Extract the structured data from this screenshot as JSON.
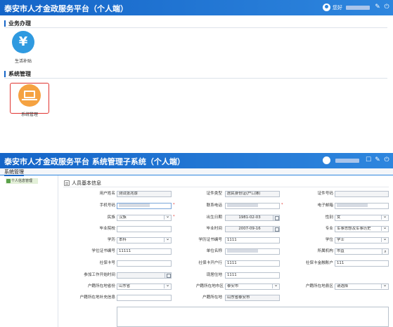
{
  "panel1": {
    "app_title": "泰安市人才金政服务平台（个人端）",
    "greeting": "您好",
    "section_business": "业务办理",
    "tile_subsidy": "生活补贴",
    "tile_subsidy_glyph": "¥",
    "section_system": "系统管理",
    "tile_system": "系统管理",
    "icons": [
      "user-icon",
      "wrench-icon",
      "power-icon",
      "yen-icon",
      "laptop-icon"
    ]
  },
  "panel2": {
    "app_title": "泰安市人才金政服务平台   系统管理子系统（个人端）",
    "nav_tab": "系统管理",
    "side_item": "个人信息管理",
    "form_title": "人员基本信息",
    "icons": [
      "user-icon",
      "edit-icon",
      "wrench-icon",
      "power-icon"
    ],
    "labels": {
      "name": "用户姓名",
      "id_type": "证件类型",
      "id_no": "证件号码",
      "phone": "手机号码",
      "contact_phone": "联系电话",
      "email": "电子邮箱",
      "ethnicity": "民族",
      "birth": "出生日期",
      "gender": "性别",
      "grad_school": "毕业院校",
      "grad_time": "毕业时间",
      "major": "专业",
      "education": "学历",
      "edu_cert_no": "学历证书编号",
      "degree": "学位",
      "degree_cert_no": "学位证书编号",
      "employer": "单位名称",
      "institution": "所属机构",
      "ss_card_no": "社保卡号",
      "ss_bank": "社保卡开户行",
      "ss_finance": "社保卡金融账户",
      "work_start": "参加工作开始时间",
      "current_addr": "现居住地",
      "hukou_prov": "户籍所在地省份",
      "hukou_city": "户籍所在地市区",
      "hukou_county": "户籍所在地县区",
      "hukou_detail": "户籍所在地补充信息",
      "hukou_full": "户籍所在地"
    },
    "values": {
      "name": "测试张兆厚",
      "id_type": "居民身份证(户口簿)",
      "ethnicity": "汉族",
      "birth": "1981-02-03",
      "gender": "女",
      "grad_time": "2007-09-16",
      "major": "军事思想及军事历史",
      "education": "本科",
      "edu_cert_no": "1111",
      "degree": "学士",
      "degree_cert_no": "11111",
      "institution": "市直",
      "ss_bank": "1111",
      "ss_finance": "111",
      "current_addr": "1111",
      "hukou_prov": "山东省",
      "hukou_city": "泰安市",
      "hukou_county": "请选择",
      "hukou_full": "山东省泰安市"
    },
    "required_mark": "*"
  }
}
